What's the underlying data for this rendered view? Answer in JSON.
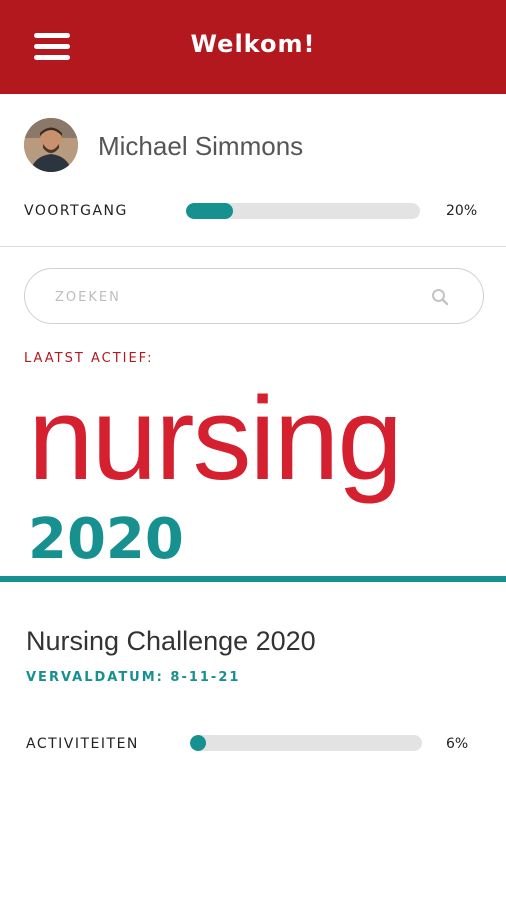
{
  "header": {
    "title": "Welkom!",
    "menu_icon": "hamburger-menu-icon"
  },
  "user": {
    "name": "Michael Simmons",
    "avatar_icon": "user-avatar"
  },
  "overall_progress": {
    "label": "VOORTGANG",
    "percent_text": "20%",
    "fraction": 0.2
  },
  "search": {
    "placeholder": "ZOEKEN",
    "value": "",
    "icon": "search-icon"
  },
  "recent": {
    "label": "LAATST ACTIEF:",
    "banner": {
      "logo_text": "nursing",
      "year": "2020"
    },
    "course_title": "Nursing Challenge 2020",
    "due": "VERVALDATUM: 8-11-21",
    "activities": {
      "label": "ACTIVITEITEN",
      "percent_text": "6%",
      "fraction": 0.06
    }
  },
  "colors": {
    "brand_red": "#b3181f",
    "teal": "#179090",
    "logo_red": "#d4202f",
    "track": "#e3e3e3"
  }
}
